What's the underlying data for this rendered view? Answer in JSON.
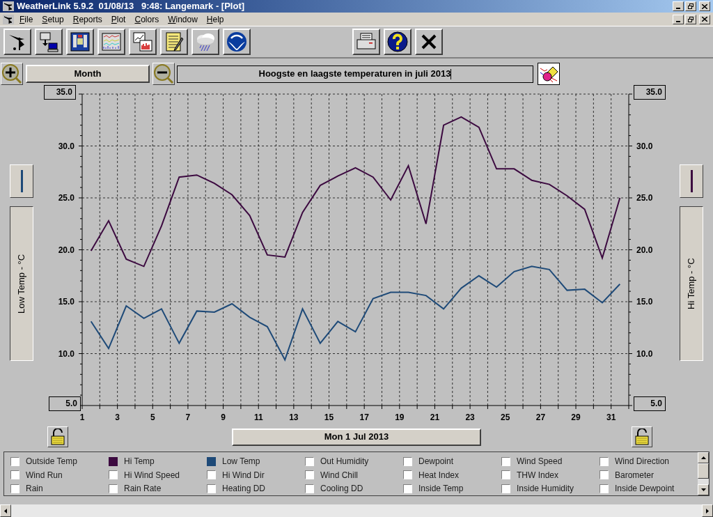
{
  "window": {
    "title": "WeatherLink 5.9.2  01/08/13   9:48: Langemark - [Plot]"
  },
  "menu": [
    "File",
    "Setup",
    "Reports",
    "Plot",
    "Colors",
    "Window",
    "Help"
  ],
  "zoom_bar": {
    "period": "Month",
    "plot_title": "Hoogste en laagste temperaturen in juli 2013"
  },
  "plot": {
    "left_axis_label": "Low Temp - °C",
    "right_axis_label": "Hi Temp - °C",
    "left_max": "35.0",
    "left_min": "5.0",
    "right_max": "35.0",
    "right_min": "5.0",
    "chart_data": {
      "type": "line",
      "xlim": [
        1,
        32
      ],
      "ylim": [
        5,
        35
      ],
      "xticks": [
        1,
        3,
        5,
        7,
        9,
        11,
        13,
        15,
        17,
        19,
        21,
        23,
        25,
        27,
        29,
        31
      ],
      "grid": true,
      "y2lim": [
        5,
        35
      ],
      "yticks": [
        {
          "value": 10,
          "label": "10.0"
        },
        {
          "value": 15,
          "label": "15.0"
        },
        {
          "value": 20,
          "label": "20.0"
        },
        {
          "value": 25,
          "label": "25.0"
        },
        {
          "value": 30,
          "label": "30.0"
        }
      ],
      "y2ticks": [
        {
          "value": 10,
          "label": "10.0"
        },
        {
          "value": 15,
          "label": "15.0"
        },
        {
          "value": 20,
          "label": "20.0"
        },
        {
          "value": 25,
          "label": "25.0"
        },
        {
          "value": 30,
          "label": "30.0"
        }
      ],
      "x": [
        1.5,
        2.5,
        3.5,
        4.5,
        5.5,
        6.5,
        7.5,
        8.5,
        9.5,
        10.5,
        11.5,
        12.5,
        13.5,
        14.5,
        15.5,
        16.5,
        17.5,
        18.5,
        19.5,
        20.5,
        21.5,
        22.5,
        23.5,
        24.5,
        25.5,
        26.5,
        27.5,
        28.5,
        29.5,
        30.5,
        31.5
      ],
      "series": [
        {
          "color": "#3c0a40",
          "values": [
            19.9,
            22.8,
            19.1,
            18.4,
            22.3,
            27.0,
            27.2,
            26.4,
            25.3,
            23.3,
            19.5,
            19.3,
            23.6,
            26.2,
            27.1,
            27.9,
            27.0,
            24.8,
            28.1,
            22.5,
            32.0,
            32.8,
            31.8,
            27.8,
            27.8,
            26.7,
            26.3,
            25.2,
            23.9,
            19.2,
            25.0
          ]
        },
        {
          "color": "#1e4a78",
          "values": [
            13.1,
            10.5,
            14.6,
            13.4,
            14.3,
            11.0,
            14.1,
            14.0,
            14.8,
            13.5,
            12.6,
            9.4,
            14.3,
            11.0,
            13.1,
            12.1,
            15.3,
            15.9,
            15.9,
            15.6,
            14.3,
            16.3,
            17.5,
            16.4,
            17.9,
            18.4,
            18.1,
            16.1,
            16.2,
            14.9,
            16.7
          ]
        }
      ]
    }
  },
  "date_button": "Mon 1 Jul 2013",
  "legend": [
    {
      "label": "Outside Temp",
      "checked": false
    },
    {
      "label": "Hi Temp",
      "checked": true,
      "color": "#3c0a40"
    },
    {
      "label": "Low Temp",
      "checked": true,
      "color": "#1e4a78"
    },
    {
      "label": "Out Humidity",
      "checked": false
    },
    {
      "label": "Dewpoint",
      "checked": false
    },
    {
      "label": "Wind Speed",
      "checked": false
    },
    {
      "label": "Wind Direction",
      "checked": false
    },
    {
      "label": "Wind Run",
      "checked": false
    },
    {
      "label": "Hi Wind Speed",
      "checked": false
    },
    {
      "label": "Hi Wind Dir",
      "checked": false
    },
    {
      "label": "Wind Chill",
      "checked": false
    },
    {
      "label": "Heat Index",
      "checked": false
    },
    {
      "label": "THW Index",
      "checked": false
    },
    {
      "label": "Barometer",
      "checked": false
    },
    {
      "label": "Rain",
      "checked": false
    },
    {
      "label": "Rain Rate",
      "checked": false
    },
    {
      "label": "Heating DD",
      "checked": false
    },
    {
      "label": "Cooling DD",
      "checked": false
    },
    {
      "label": "Inside Temp",
      "checked": false
    },
    {
      "label": "Inside Humidity",
      "checked": false
    },
    {
      "label": "Inside Dewpoint",
      "checked": false
    }
  ]
}
